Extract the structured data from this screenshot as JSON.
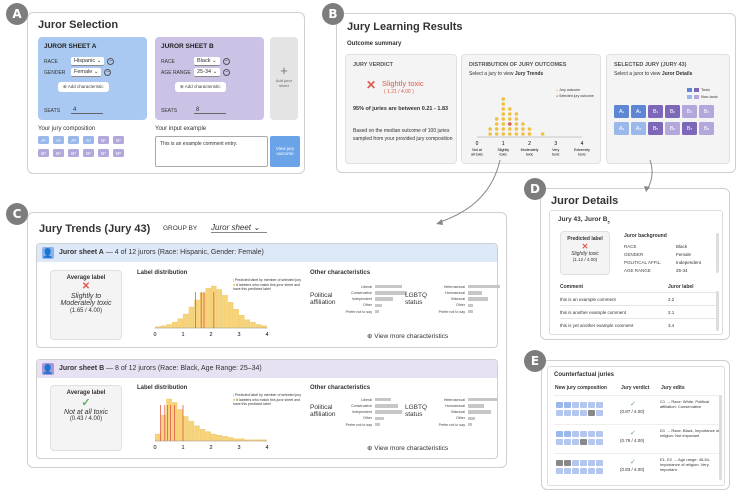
{
  "badges": {
    "a": "A",
    "b": "B",
    "c": "C",
    "d": "D",
    "e": "E"
  },
  "juror_selection": {
    "title": "Juror Selection",
    "sheet_a": {
      "title": "JUROR SHEET A",
      "race_label": "RACE",
      "race_value": "Hispanic",
      "gender_label": "GENDER",
      "gender_value": "Female",
      "add": "Add characteristic",
      "seats_label": "SEATS",
      "seats_value": "4"
    },
    "sheet_b": {
      "title": "JUROR SHEET B",
      "race_label": "RACE",
      "race_value": "Black",
      "age_label": "AGE RANGE",
      "age_value": "25-34",
      "add": "Add characteristic",
      "seats_label": "SEATS",
      "seats_value": "8"
    },
    "add_sheet": "Add juror sheet",
    "composition_label": "Your jury composition",
    "input_label": "Your input example",
    "input_value": "This is an example comment entry.",
    "view_button": "View jury outcome",
    "chips_row1": [
      "A1",
      "A2",
      "A3",
      "A4",
      "B1",
      "B2"
    ],
    "chips_row2": [
      "B3",
      "B4",
      "B5",
      "B6",
      "B7",
      "B8"
    ]
  },
  "results": {
    "title": "Jury Learning Results",
    "subtitle": "Outcome summary",
    "verdict": {
      "heading": "JURY VERDICT",
      "label": "Slightly toxic",
      "score": "( 1.21 / 4.00 )",
      "stat": "95% of juries are between 0.21 - 1.83",
      "note": "Based on the median outcome of 100 juries sampled from your provided jury composition"
    },
    "distribution": {
      "heading": "DISTRIBUTION OF JURY OUTCOMES",
      "sub_prefix": "Select a jury to view ",
      "sub_bold": "Jury Trends",
      "legend_a": "Jury outcome",
      "legend_b": "Selected jury outcome",
      "ticks": [
        "0",
        "1",
        "2",
        "3",
        "4"
      ],
      "tick_labels": [
        "Not at all toxic",
        "Slightly toxic",
        "Moderately toxic",
        "Very toxic",
        "Extremely toxic"
      ]
    },
    "selected": {
      "heading": "SELECTED JURY (JURY 43)",
      "sub_prefix": "Select a juror to view ",
      "sub_bold": "Juror Details",
      "legend_a": "Toxic",
      "legend_b": "Non-toxic",
      "row1": [
        "A1",
        "A2",
        "B1",
        "B2",
        "B3",
        "B4"
      ],
      "row2": [
        "A3",
        "A4",
        "B5",
        "B6",
        "B7",
        "B8"
      ]
    }
  },
  "trends": {
    "title": "Jury Trends (Jury 43)",
    "group_by": "GROUP BY",
    "group_value": "Juror sheet",
    "sheet_a": {
      "name": "Juror sheet A",
      "desc": "— 4 of 12 jurors (Race: Hispanic, Gender: Female)",
      "avg_heading": "Average label",
      "avg_text": "Slightly to Moderately toxic",
      "avg_score": "(1.65 / 4.00)",
      "dist_heading": "Label distribution",
      "legend_a": "Predicted label by member of selected jury",
      "legend_b": "# labelers who match this juror sheet and have this predicted label"
    },
    "sheet_b": {
      "name": "Juror sheet B",
      "desc": "— 8 of 12 jurors (Race: Black, Age Range: 25–34)",
      "avg_heading": "Average label",
      "avg_text": "Not at all toxic",
      "avg_score": "(0.43 / 4.00)",
      "dist_heading": "Label distribution",
      "legend_a": "Predicted label by member of selected jury",
      "legend_b": "# labelers who match this juror sheet and have this predicted label"
    },
    "other_heading": "Other characteristics",
    "political": "Political affiliation",
    "lgbtq": "LGBTQ status",
    "pol_items": [
      "Liberal",
      "Conservative",
      "Independent",
      "Other",
      "Prefer not to say"
    ],
    "lgbtq_items": [
      "Heterosexual",
      "Homosexual",
      "Bisexual",
      "Other",
      "Prefer not to say"
    ],
    "view_more": "View more characteristics",
    "axis": [
      "0",
      "1",
      "2",
      "3",
      "4"
    ]
  },
  "juror_details": {
    "title": "Juror Details",
    "heading_prefix": "Jury 43, Juror B",
    "heading_sub": "5",
    "pred_heading": "Predicted label",
    "pred_text": "Slightly toxic",
    "pred_score": "(1.12 / 4.00)",
    "bg_heading": "Juror background",
    "bg": [
      {
        "k": "RACE",
        "v": "Black"
      },
      {
        "k": "GENDER",
        "v": "Female"
      },
      {
        "k": "POLITICAL AFFIL.",
        "v": "Independent"
      },
      {
        "k": "AGE RANGE",
        "v": "25-34"
      }
    ],
    "comment_h": "Comment",
    "label_h": "Juror label",
    "comments": [
      {
        "c": "this is an example comment",
        "l": "2.2"
      },
      {
        "c": "this is another example comment",
        "l": "2.1"
      },
      {
        "c": "this is yet another example comment",
        "l": "3.4"
      }
    ]
  },
  "counterfactual": {
    "title": "Counterfactual juries",
    "h1": "New jury composition",
    "h2": "Jury verdict",
    "h3": "Jury edits",
    "rows": [
      {
        "score": "(0.87 / 4.00)",
        "edit": "C1 → Race: White, Political affiliation: Conservative"
      },
      {
        "score": "(0.79 / 4.00)",
        "edit": "D1 → Race: Black, Importance of religion: Not important"
      },
      {
        "score": "(0.83 / 4.00)",
        "edit": "E1, E2 → Age range: 45-54, Importance of religion: Very important"
      }
    ]
  },
  "colors": {
    "sheet_a": "#a9c8f2",
    "sheet_b": "#ccc2e6",
    "toxic": "#e05a4a",
    "button": "#6aa3e8",
    "check": "#5cae6b"
  },
  "chart_data": [
    {
      "type": "bar",
      "title": "Label distribution",
      "series": [
        {
          "name": "Juror sheet A",
          "values": [
            1,
            2,
            3,
            5,
            8,
            12,
            18,
            24,
            30,
            34,
            36,
            33,
            28,
            22,
            16,
            11,
            7,
            5,
            3,
            2
          ]
        }
      ],
      "x_range": [
        0,
        4
      ]
    },
    {
      "type": "bar",
      "title": "Label distribution",
      "series": [
        {
          "name": "Juror sheet B",
          "values": [
            6,
            22,
            36,
            33,
            27,
            21,
            17,
            13,
            10,
            8,
            6,
            5,
            4,
            3,
            2,
            2,
            1,
            1,
            1,
            1
          ]
        }
      ],
      "x_range": [
        0,
        4
      ]
    }
  ]
}
